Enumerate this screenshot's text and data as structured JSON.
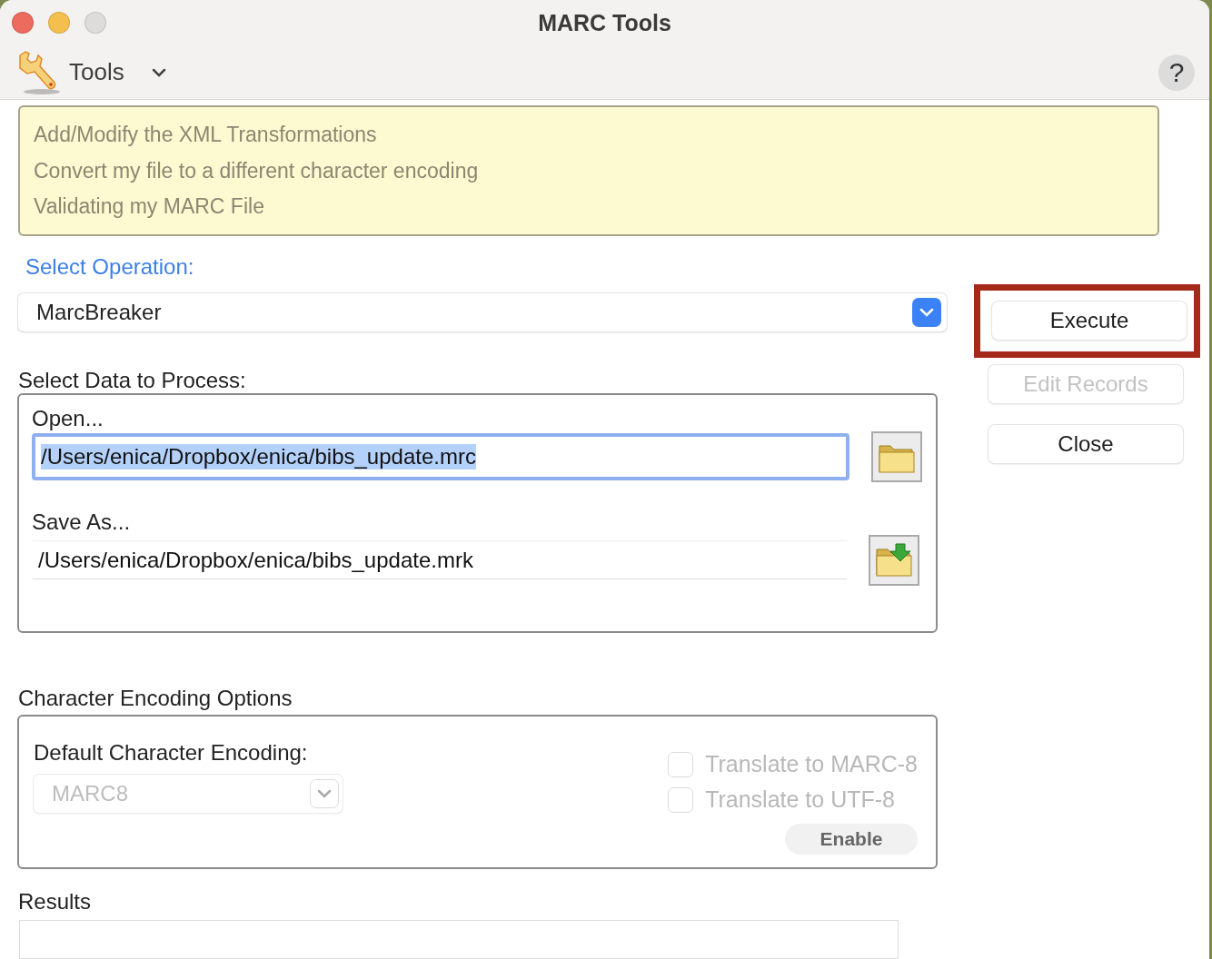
{
  "window": {
    "title": "MARC Tools"
  },
  "toolbar": {
    "menu": "Tools",
    "help": "?"
  },
  "tips": [
    "Add/Modify the XML Transformations",
    "Convert my file to a different character encoding",
    "Validating my MARC File"
  ],
  "operation": {
    "label": "Select Operation:",
    "value": "MarcBreaker"
  },
  "buttons": [
    {
      "label": "Execute",
      "disabled": false,
      "highlighted": true
    },
    {
      "label": "Edit Records",
      "disabled": true,
      "highlighted": false
    },
    {
      "label": "Close",
      "disabled": false,
      "highlighted": false
    }
  ],
  "data": {
    "label": "Select Data to Process:",
    "open_label": "Open...",
    "open_value": "/Users/enica/Dropbox/enica/bibs_update.mrc",
    "open_selected": true,
    "save_label": "Save As...",
    "save_value": "/Users/enica/Dropbox/enica/bibs_update.mrk"
  },
  "encoding": {
    "title": "Character Encoding Options",
    "default_label": "Default Character Encoding:",
    "default_value": "MARC8",
    "default_disabled": true,
    "checkboxes": [
      {
        "label": "Translate to MARC-8",
        "checked": false,
        "disabled": true
      },
      {
        "label": "Translate to UTF-8",
        "checked": false,
        "disabled": true
      }
    ],
    "enable": "Enable"
  },
  "results": {
    "label": "Results"
  }
}
